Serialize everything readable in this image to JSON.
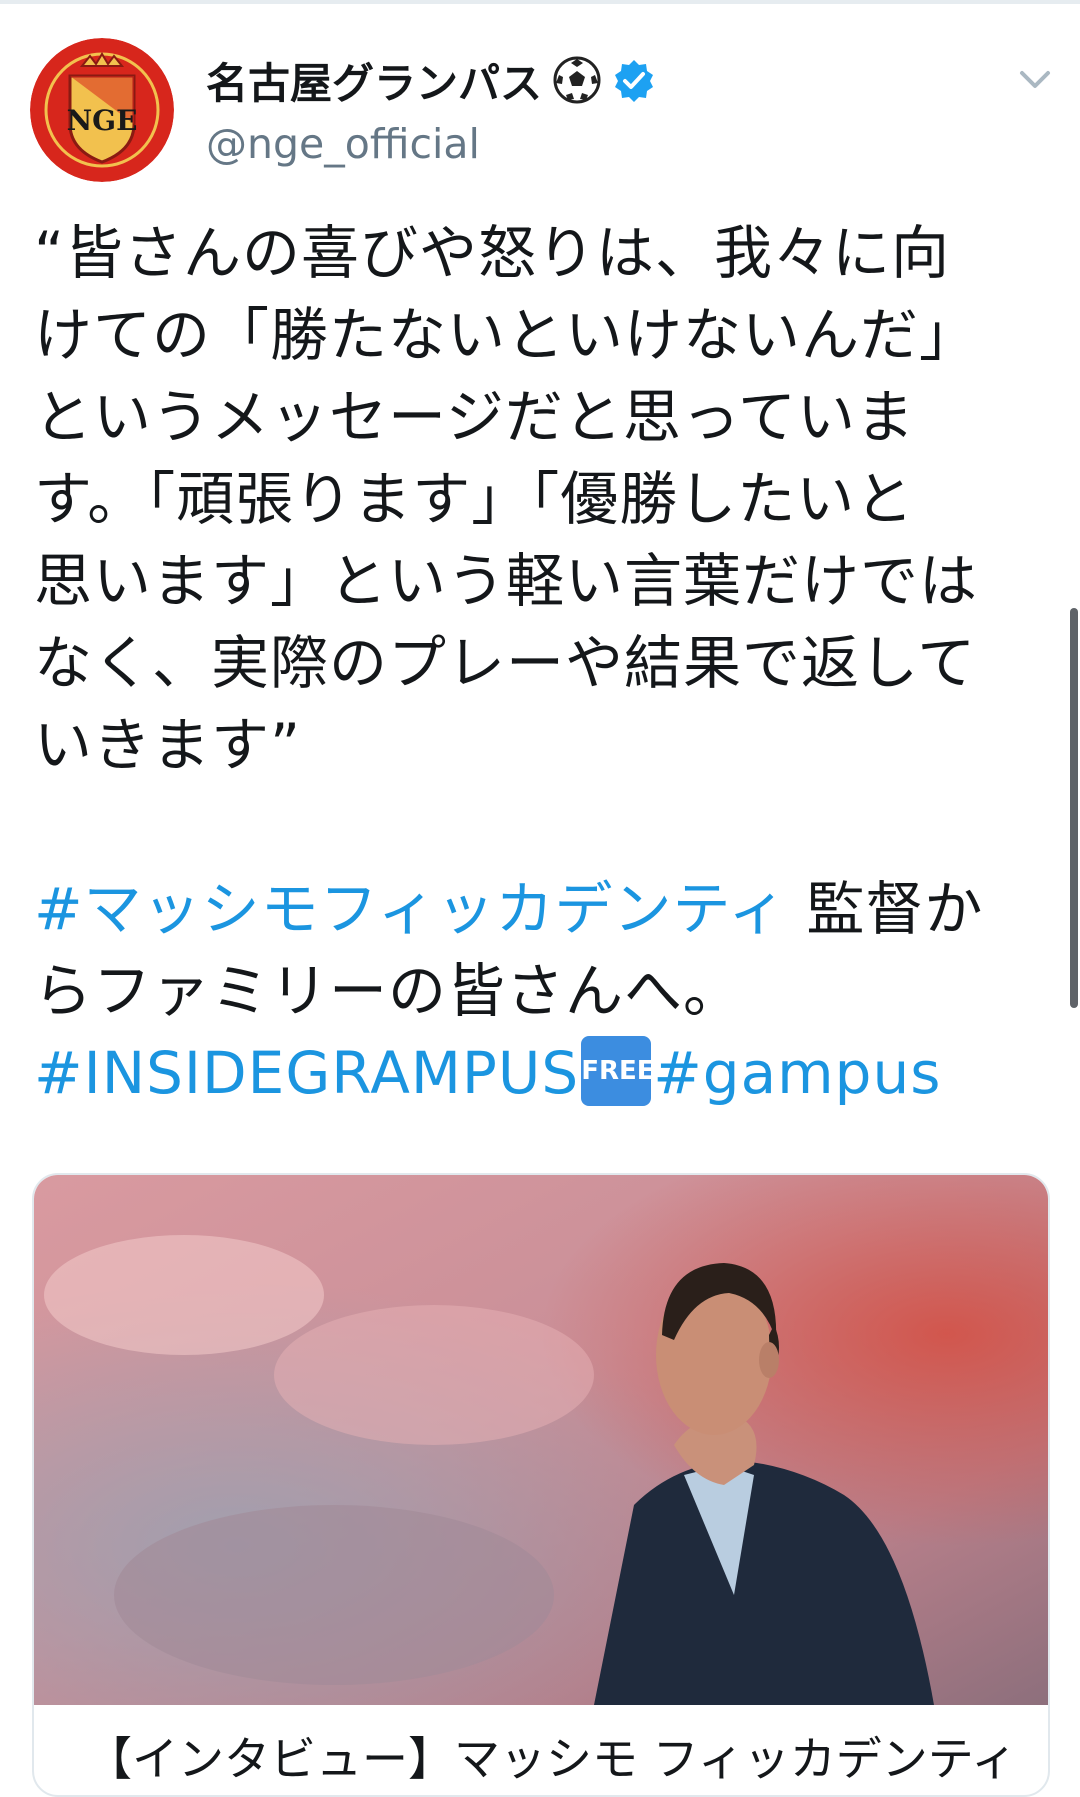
{
  "author": {
    "display_name": "名古屋グランパス",
    "handle": "@nge_official",
    "avatar_icon": "nagoya-grampus-crest",
    "badges": [
      "soccer-ball-icon",
      "verified-badge-icon"
    ]
  },
  "menu": {
    "icon": "chevron-down-icon"
  },
  "tweet": {
    "lines": [
      "“皆さんの喜びや怒りは、我々に向",
      "けての「勝たないといけないんだ」",
      "というメッセージだと思っていま",
      "す。「頑張ります」「優勝したいと",
      "思います」という軽い言葉だけでは",
      "なく、実際のプレーや結果で返して",
      "いきます”"
    ],
    "hashtag_1": "#マッシモフィッカデンティ",
    "text_after_hashtag_1": " 監督か",
    "line_continuation": "らファミリーの皆さんへ。",
    "hashtag_2": "#INSIDEGRAMPUS",
    "free_badge": "FREE",
    "hashtag_3": "#gampus"
  },
  "link_card": {
    "image_icon": "coach-photo",
    "title": "【インタビュー】マッシモ フィッカデンティ"
  },
  "colors": {
    "link": "#1b95e0",
    "text": "#14171a",
    "muted": "#657786",
    "verified": "#1da1f2",
    "free_badge": "#3c8de0",
    "crest_red": "#d7261c",
    "crest_gold": "#f2c14e"
  }
}
